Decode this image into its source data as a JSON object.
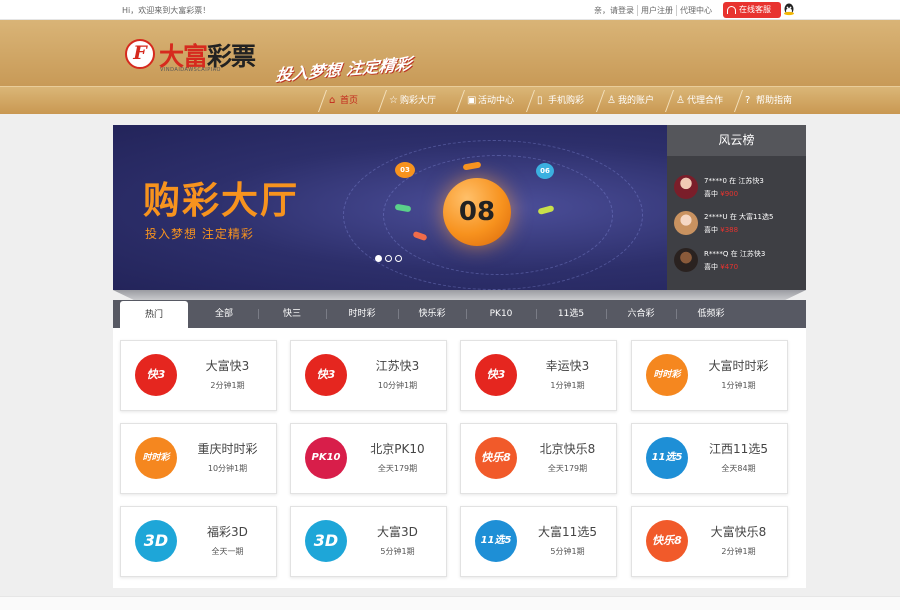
{
  "topbar": {
    "welcome": "Hi，欢迎来到大富彩票！",
    "links": [
      "亲，请登录",
      "用户注册",
      "代理中心"
    ],
    "service_label": "在线客服"
  },
  "header": {
    "logo_letter": "F",
    "logo_text_a": "大富",
    "logo_text_b": "彩票",
    "logo_sub": "VINDAIDAWSCAIPIAO",
    "slogan": "投入梦想 注定精彩"
  },
  "nav": [
    {
      "label": "首页",
      "icon": "home-icon",
      "active": true
    },
    {
      "label": "购彩大厅",
      "icon": "star-icon",
      "active": false
    },
    {
      "label": "活动中心",
      "icon": "gift-icon",
      "active": false
    },
    {
      "label": "手机购彩",
      "icon": "mobile-icon",
      "active": false
    },
    {
      "label": "我的账户",
      "icon": "user-icon",
      "active": false
    },
    {
      "label": "代理合作",
      "icon": "agent-icon",
      "active": false
    },
    {
      "label": "帮助指南",
      "icon": "help-icon",
      "active": false
    }
  ],
  "banner": {
    "title": "购彩大厅",
    "subtitle": "投入梦想  注定精彩",
    "ball_main": "08",
    "ball_a": "03",
    "ball_b": "06",
    "slide_count": 3,
    "active_slide": 0
  },
  "ranking": {
    "title": "风云榜",
    "items": [
      {
        "user": "7****0",
        "word_in": "在",
        "game": "江苏快3",
        "win_label": "喜中",
        "amount": "¥900"
      },
      {
        "user": "2****U",
        "word_in": "在",
        "game": "大富11选5",
        "win_label": "喜中",
        "amount": "¥388"
      },
      {
        "user": "R****Q",
        "word_in": "在",
        "game": "江苏快3",
        "win_label": "喜中",
        "amount": "¥470"
      }
    ]
  },
  "tabs": [
    "热门",
    "全部",
    "快三",
    "时时彩",
    "快乐彩",
    "PK10",
    "11选5",
    "六合彩",
    "低频彩"
  ],
  "games": [
    {
      "name": "大富快3",
      "freq": "2分钟1期",
      "logo": "快3",
      "color": "#e5261f"
    },
    {
      "name": "江苏快3",
      "freq": "10分钟1期",
      "logo": "快3",
      "color": "#e5261f"
    },
    {
      "name": "幸运快3",
      "freq": "1分钟1期",
      "logo": "快3",
      "color": "#e5261f"
    },
    {
      "name": "大富时时彩",
      "freq": "1分钟1期",
      "logo": "时时彩",
      "color": "#f5871f"
    },
    {
      "name": "重庆时时彩",
      "freq": "10分钟1期",
      "logo": "时时彩",
      "color": "#f5871f"
    },
    {
      "name": "北京PK10",
      "freq": "全天179期",
      "logo": "PK10",
      "color": "#d81e4a"
    },
    {
      "name": "北京快乐8",
      "freq": "全天179期",
      "logo": "快乐8",
      "color": "#f15a2a"
    },
    {
      "name": "江西11选5",
      "freq": "全天84期",
      "logo": "11选5",
      "color": "#1e8fd6"
    },
    {
      "name": "福彩3D",
      "freq": "全天一期",
      "logo": "3D",
      "color": "#1ea6d8"
    },
    {
      "name": "大富3D",
      "freq": "5分钟1期",
      "logo": "3D",
      "color": "#1ea6d8"
    },
    {
      "name": "大富11选5",
      "freq": "5分钟1期",
      "logo": "11选5",
      "color": "#1e8fd6"
    },
    {
      "name": "大富快乐8",
      "freq": "2分钟1期",
      "logo": "快乐8",
      "color": "#f15a2a"
    }
  ],
  "colors": {
    "accent_red": "#e8332f",
    "gold": "#c99852",
    "tab_bar": "#575963"
  }
}
